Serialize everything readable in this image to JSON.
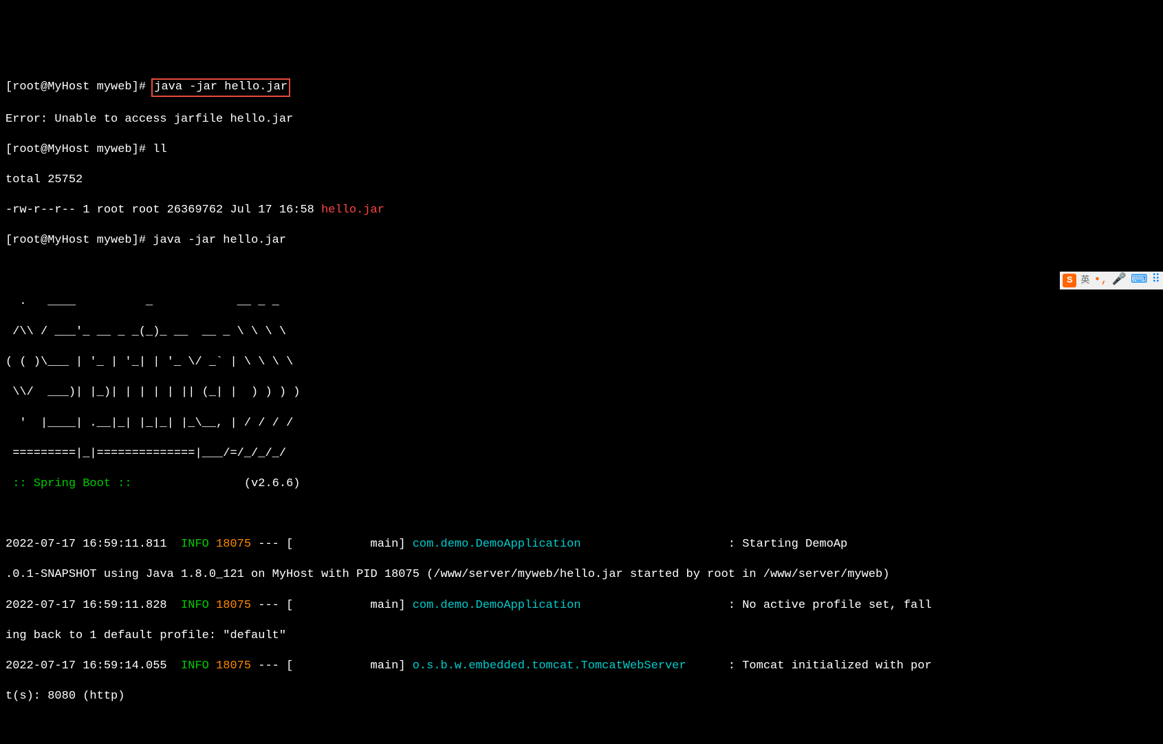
{
  "terminal": {
    "prompt": "[root@MyHost myweb]# ",
    "lines": {
      "l1_cmd": "java -jar hello.jar",
      "l2_error": "Error: Unable to access jarfile hello.jar",
      "l3_cmd": "ll",
      "l4_total": "total 25752",
      "l5_perms": "-rw-r--r-- 1 root root 26369762 Jul 17 16:58 ",
      "l5_file": "hello.jar",
      "l6_cmd": "java -jar hello.jar"
    },
    "banner": {
      "r1": "  .   ____          _            __ _ _",
      "r2": " /\\\\ / ___'_ __ _ _(_)_ __  __ _ \\ \\ \\ \\",
      "r3": "( ( )\\___ | '_ | '_| | '_ \\/ _` | \\ \\ \\ \\",
      "r4": " \\\\/  ___)| |_)| | | | | || (_| |  ) ) ) )",
      "r5": "  '  |____| .__|_| |_|_| |_\\__, | / / / /",
      "r6": " =========|_|==============|___/=/_/_/_/",
      "r7_label": " :: Spring Boot :: ",
      "r7_version": "               (v2.6.6)"
    },
    "logs": {
      "row1": {
        "ts": "2022-07-17 16:59:11.811  ",
        "level": "INFO",
        "pid": " 18075",
        "sep": " --- [           main] ",
        "class": "com.demo.DemoApplication",
        "pad": "                    ",
        "msg": " : Starting DemoAp"
      },
      "row1b": ".0.1-SNAPSHOT using Java 1.8.0_121 on MyHost with PID 18075 (/www/server/myweb/hello.jar started by root in /www/server/myweb)",
      "row2": {
        "ts": "2022-07-17 16:59:11.828  ",
        "level": "INFO",
        "pid": " 18075",
        "sep": " --- [           main] ",
        "class": "com.demo.DemoApplication",
        "pad": "                    ",
        "msg": " : No active profile set, fall"
      },
      "row2b": "ing back to 1 default profile: \"default\"",
      "row3": {
        "ts": "2022-07-17 16:59:14.055  ",
        "level": "INFO",
        "pid": " 18075",
        "sep": " --- [           main] ",
        "class": "o.s.b.w.embedded.tomcat.TomcatWebServer",
        "pad": "     ",
        "msg": " : Tomcat initialized with por"
      },
      "row3b": "t(s): 8080 (http)"
    }
  },
  "ime": {
    "s": "S",
    "lang": "英",
    "comma": "•,",
    "mic": "🎤",
    "kbd": "⌨",
    "menu": "⠿"
  }
}
